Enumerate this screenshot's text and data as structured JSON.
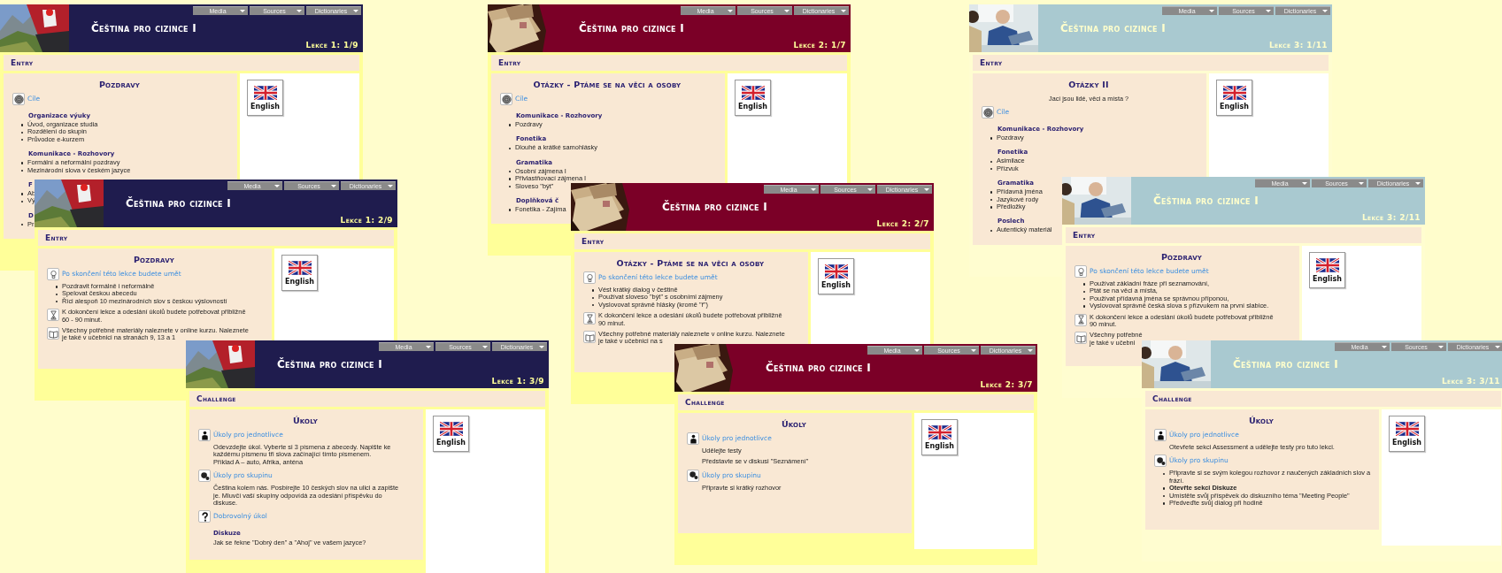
{
  "pages": [
    {
      "color": "#1f1c4e",
      "menus": [
        "Media",
        "Sources",
        "Dictionaries"
      ],
      "title": "Čeština pro cizince I",
      "lesson": "Lekce 1: 1/9",
      "section": "Entry",
      "heading": "Pozdravy",
      "language_button": "English",
      "items": [
        {
          "kind": "goals",
          "text": "Cíle"
        },
        {
          "kind": "subhead",
          "text": "Organizace výuky"
        },
        {
          "kind": "bullets",
          "items": [
            "Úvod, organizace studia",
            "Rozdělení do skupin",
            "Průvodce e-kurzem"
          ]
        },
        {
          "kind": "subhead",
          "text": "Komunikace - Rozhovory"
        },
        {
          "kind": "bullets",
          "items": [
            "Formální a neformální pozdravy",
            "Mezinárodní slova v českém jazyce"
          ]
        },
        {
          "kind": "subhead",
          "text": "F"
        },
        {
          "kind": "bullets",
          "items": [
            "Ab",
            "Vý"
          ]
        },
        {
          "kind": "subhead",
          "text": "D"
        },
        {
          "kind": "bullets",
          "items": [
            "Pr"
          ]
        }
      ]
    },
    {
      "color": "#1f1c4e",
      "menus": [
        "Media",
        "Sources",
        "Dictionaries"
      ],
      "title": "Čeština pro cizince I",
      "lesson": "Lekce 1: 2/9",
      "section": "Entry",
      "heading": "Pozdravy",
      "language_button": "English",
      "items": [
        {
          "kind": "outcomes",
          "text": "Po skončení této lekce budete umět"
        },
        {
          "kind": "bullets",
          "items": [
            "Pozdravit formálně i neformálně",
            "Spelovat českou abecedu",
            "Říci alespoň 10 mezinárodních slov s českou výslovností"
          ]
        },
        {
          "kind": "time",
          "lines": [
            "K dokončení lekce a odeslání úkolů budete potřebovat přibližně",
            "60 - 90 minut."
          ]
        },
        {
          "kind": "materials",
          "lines": [
            "Všechny potřebné materiály naleznete v online kurzu. Naleznete",
            "je také v učebnici na stranách 9, 13 a 1"
          ]
        }
      ]
    },
    {
      "color": "#1f1c4e",
      "menus": [
        "Media",
        "Sources",
        "Dictionaries"
      ],
      "title": "Čeština pro cizince I",
      "lesson": "Lekce 1: 3/9",
      "section": "Challenge",
      "heading": "Úkoly",
      "language_button": "English",
      "items": [
        {
          "kind": "individual",
          "text": "Úkoly pro jednotlivce"
        },
        {
          "kind": "para",
          "lines": [
            "Odevzdejte úkol. Vyberte si 3 písmena z abecedy. Napište ke",
            "každému písmenu tři slova začínající tímto písmenem.",
            "Příklad A – auto, Afrika, anténa"
          ]
        },
        {
          "kind": "group",
          "text": "Úkoly pro skupinu"
        },
        {
          "kind": "para",
          "lines": [
            "Čeština kolem nás. Posbírejte 10 českých slov na ulici a zapište",
            "je. Mluvčí vaší skupiny odpovídá za odeslání příspěvku do",
            "diskuse."
          ]
        },
        {
          "kind": "optional",
          "text": "Dobrovolný úkol"
        },
        {
          "kind": "label",
          "text": "Diskuze"
        },
        {
          "kind": "para",
          "lines": [
            "Jak se řekne \"Dobrý den\" a \"Ahoj\" ve vašem jazyce?"
          ]
        }
      ]
    },
    {
      "color": "#7b0027",
      "menus": [
        "Media",
        "Sources",
        "Dictionaries"
      ],
      "title": "Čeština pro cizince I",
      "lesson": "Lekce 2: 1/7",
      "section": "Entry",
      "heading": "Otázky - Ptáme se na věci a osoby",
      "language_button": "English",
      "items": [
        {
          "kind": "goals",
          "text": "Cíle"
        },
        {
          "kind": "subhead",
          "text": "Komunikace - Rozhovory"
        },
        {
          "kind": "bullets",
          "items": [
            "Pozdravy"
          ]
        },
        {
          "kind": "subhead",
          "text": "Fonetika"
        },
        {
          "kind": "bullets",
          "items": [
            "Dlouhé a krátké samohlásky"
          ]
        },
        {
          "kind": "subhead",
          "text": "Gramatika"
        },
        {
          "kind": "bullets",
          "items": [
            "Osobní zájmena I",
            "Přivlastňovací zájmena I",
            "Sloveso \"být\""
          ]
        },
        {
          "kind": "subhead",
          "text": "Doplňková č"
        },
        {
          "kind": "bullets",
          "items": [
            "Fonetika - Zajíma"
          ]
        }
      ]
    },
    {
      "color": "#7b0027",
      "menus": [
        "Media",
        "Sources",
        "Dictionaries"
      ],
      "title": "Čeština pro cizince I",
      "lesson": "Lekce 2: 2/7",
      "section": "Entry",
      "heading": "Otázky - Ptáme se na věci a osoby",
      "language_button": "English",
      "items": [
        {
          "kind": "outcomes",
          "text": "Po skončení této lekce budete umět"
        },
        {
          "kind": "bullets",
          "items": [
            "Vést krátký dialog v češtině",
            "Používat sloveso \"být\" s osobními zájmeny",
            "Vyslovovat správně hlásky (kromě \"ř\")"
          ]
        },
        {
          "kind": "time",
          "lines": [
            "K dokončení lekce a odeslání úkolů budete potřebovat přibližně",
            "90 minut."
          ]
        },
        {
          "kind": "materials",
          "lines": [
            "Všechny potřebné materiály naleznete v online kurzu. Naleznete",
            "je také v učebnici na s"
          ]
        }
      ]
    },
    {
      "color": "#7b0027",
      "menus": [
        "Media",
        "Sources",
        "Dictionaries"
      ],
      "title": "Čeština pro cizince I",
      "lesson": "Lekce 2: 3/7",
      "section": "Challenge",
      "heading": "Úkoly",
      "language_button": "English",
      "items": [
        {
          "kind": "individual",
          "text": "Úkoly pro jednotlivce"
        },
        {
          "kind": "para",
          "lines": [
            "Udělejte testy"
          ]
        },
        {
          "kind": "para",
          "lines": [
            "Představte se v diskusi \"Seznámení\""
          ]
        },
        {
          "kind": "group",
          "text": "Úkoly pro skupinu"
        },
        {
          "kind": "para",
          "lines": [
            "Připravte si krátký rozhovor"
          ]
        }
      ]
    },
    {
      "color": "#a9c9d0",
      "menus": [
        "Media",
        "Sources",
        "Dictionaries"
      ],
      "title": "Čeština pro cizince I",
      "lesson": "Lekce 3: 1/11",
      "section": "Entry",
      "heading": "Otázky II",
      "language_button": "English",
      "items": [
        {
          "kind": "subtitle",
          "text": "Jací jsou lidé, věci a místa ?"
        },
        {
          "kind": "goals",
          "text": "Cíle"
        },
        {
          "kind": "subhead",
          "text": "Komunikace - Rozhovory"
        },
        {
          "kind": "bullets",
          "items": [
            "Pozdravy"
          ]
        },
        {
          "kind": "subhead",
          "text": "Fonetika"
        },
        {
          "kind": "bullets",
          "items": [
            "Asimilace",
            "Přízvuk"
          ]
        },
        {
          "kind": "subhead",
          "text": "Gramatika"
        },
        {
          "kind": "bullets",
          "items": [
            "Přídavná jména",
            "Jazykové rody",
            "Předložky"
          ]
        },
        {
          "kind": "subhead",
          "text": "Poslech"
        },
        {
          "kind": "bullets",
          "items": [
            "Autentický materiál"
          ]
        }
      ]
    },
    {
      "color": "#a9c9d0",
      "menus": [
        "Media",
        "Sources",
        "Dictionaries"
      ],
      "title": "Čeština pro cizince I",
      "lesson": "Lekce 3: 2/11",
      "section": "Entry",
      "heading": "Pozdravy",
      "language_button": "English",
      "items": [
        {
          "kind": "outcomes",
          "text": "Po skončení této lekce budete umět"
        },
        {
          "kind": "bullets",
          "items": [
            "Používat základní fráze při seznamování,",
            "Ptát se na věci a místa,",
            "Používat přídavná jména se správnou příponou,",
            "Vyslovovat správně česká slova s přízvukem na první slabice."
          ]
        },
        {
          "kind": "time",
          "lines": [
            "K dokončení lekce a odeslání úkolů budete potřebovat přibližně",
            "90 minut."
          ]
        },
        {
          "kind": "materials",
          "lines": [
            "Všechny potřebné",
            "je také v učebni"
          ]
        }
      ]
    },
    {
      "color": "#a9c9d0",
      "menus": [
        "Media",
        "Sources",
        "Dictionaries"
      ],
      "title": "Čeština pro cizince I",
      "lesson": "Lekce 3: 3/11",
      "section": "Challenge",
      "heading": "Úkoly",
      "language_button": "English",
      "items": [
        {
          "kind": "individual",
          "text": "Úkoly pro jednotlivce"
        },
        {
          "kind": "para",
          "lines": [
            "Otevřete sekci Assessment a udělejte testy pro tuto lekci."
          ]
        },
        {
          "kind": "group",
          "text": "Úkoly pro skupinu"
        },
        {
          "kind": "bullets",
          "items": [
            {
              "text": "Připravte si se svým kolegou rozhovor z naučených základních slov a frází.",
              "bold": false
            },
            {
              "text": "Otevřte sekci Diskuze",
              "bold": true
            },
            {
              "text": "Umístěte svůj příspěvek do diskuzního téma \"Meeting People\"",
              "bold": false
            },
            {
              "text": "Předveďte svůj dialog při hodině",
              "bold": false
            }
          ]
        }
      ]
    }
  ]
}
